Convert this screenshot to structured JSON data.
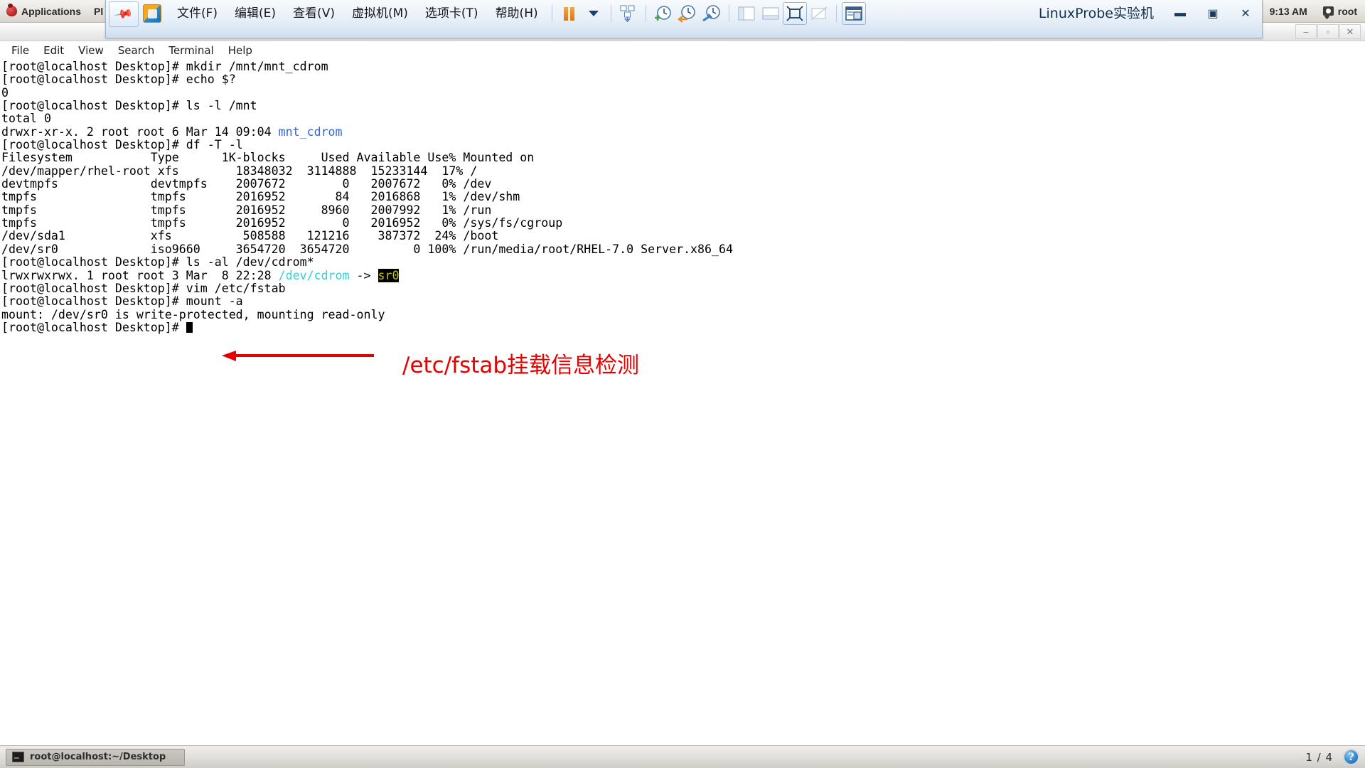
{
  "gnome_panel": {
    "applications_label": "Applications",
    "places_label": "Pl",
    "clock": "9:13 AM",
    "user": "root"
  },
  "vmware": {
    "menu": [
      {
        "label": "文件(F)"
      },
      {
        "label": "编辑(E)"
      },
      {
        "label": "查看(V)"
      },
      {
        "label": "虚拟机(M)"
      },
      {
        "label": "选项卡(T)"
      },
      {
        "label": "帮助(H)"
      }
    ],
    "title": "LinuxProbe实验机",
    "icons": {
      "pin": "pin-icon",
      "app_logo": "vmware-logo-icon",
      "pause": "pause-icon",
      "caret": "chevron-down-icon",
      "snapshot_manager": "snapshot-manager-icon",
      "take_snapshot": "take-snapshot-icon",
      "revert_snapshot": "revert-snapshot-icon",
      "manage_snapshots": "manage-snapshots-icon",
      "show_library": "show-library-icon",
      "show_thumbnails": "show-thumbnail-bar-icon",
      "full_screen": "full-screen-icon",
      "unity": "unity-mode-icon",
      "console_view": "console-view-icon"
    },
    "window_buttons": {
      "minimize": "▬",
      "restore": "▣",
      "close": "✕"
    }
  },
  "terminal_window": {
    "title": "root@localhost:~/Desktop",
    "menu": [
      "File",
      "Edit",
      "View",
      "Search",
      "Terminal",
      "Help"
    ],
    "window_buttons": {
      "minimize": "‒",
      "maximize": "▫",
      "close": "✕"
    }
  },
  "terminal": {
    "prompt": "[root@localhost Desktop]# ",
    "lines": [
      {
        "type": "cmd",
        "text": "mkdir /mnt/mnt_cdrom"
      },
      {
        "type": "cmd",
        "text": "echo $?"
      },
      {
        "type": "out",
        "text": "0"
      },
      {
        "type": "cmd",
        "text": "ls -l /mnt"
      },
      {
        "type": "out",
        "text": "total 0"
      },
      {
        "type": "out_dir",
        "pre": "drwxr-xr-x. 2 root root 6 Mar 14 09:04 ",
        "dir": "mnt_cdrom"
      },
      {
        "type": "cmd",
        "text": "df -T -l"
      },
      {
        "type": "out",
        "text": "Filesystem           Type      1K-blocks     Used Available Use% Mounted on"
      },
      {
        "type": "out",
        "text": "/dev/mapper/rhel-root xfs        18348032  3114888  15233144  17% /"
      },
      {
        "type": "out",
        "text": "devtmpfs             devtmpfs    2007672        0   2007672   0% /dev"
      },
      {
        "type": "out",
        "text": "tmpfs                tmpfs       2016952       84   2016868   1% /dev/shm"
      },
      {
        "type": "out",
        "text": "tmpfs                tmpfs       2016952     8960   2007992   1% /run"
      },
      {
        "type": "out",
        "text": "tmpfs                tmpfs       2016952        0   2016952   0% /sys/fs/cgroup"
      },
      {
        "type": "out",
        "text": "/dev/sda1            xfs          508588   121216    387372  24% /boot"
      },
      {
        "type": "out",
        "text": "/dev/sr0             iso9660     3654720  3654720         0 100% /run/media/root/RHEL-7.0 Server.x86_64"
      },
      {
        "type": "cmd",
        "text": "ls -al /dev/cdrom*"
      },
      {
        "type": "symlink",
        "pre": "lrwxrwxrwx. 1 root root 3 Mar  8 22:28 ",
        "link": "/dev/cdrom",
        "arrow": " -> ",
        "target": "sr0"
      },
      {
        "type": "cmd",
        "text": "vim /etc/fstab"
      },
      {
        "type": "cmd",
        "text": "mount -a"
      },
      {
        "type": "out",
        "text": "mount: /dev/sr0 is write-protected, mounting read-only"
      },
      {
        "type": "cursor",
        "text": ""
      }
    ]
  },
  "annotation": {
    "text": "/etc/fstab挂载信息检测",
    "color": "#e70000"
  },
  "taskbar": {
    "task_label": "root@localhost:~/Desktop",
    "workspace": "1 / 4",
    "help_orb": "?"
  },
  "colors": {
    "terminal_bg": "#ffffff",
    "terminal_fg": "#000000",
    "dir_blue": "#3465d4",
    "symlink_cyan": "#2dd3d3",
    "highlight_bg": "#000000",
    "highlight_fg": "#c3c300",
    "annotation_red": "#e70000",
    "vmware_chrome": "#dbe7f4"
  }
}
